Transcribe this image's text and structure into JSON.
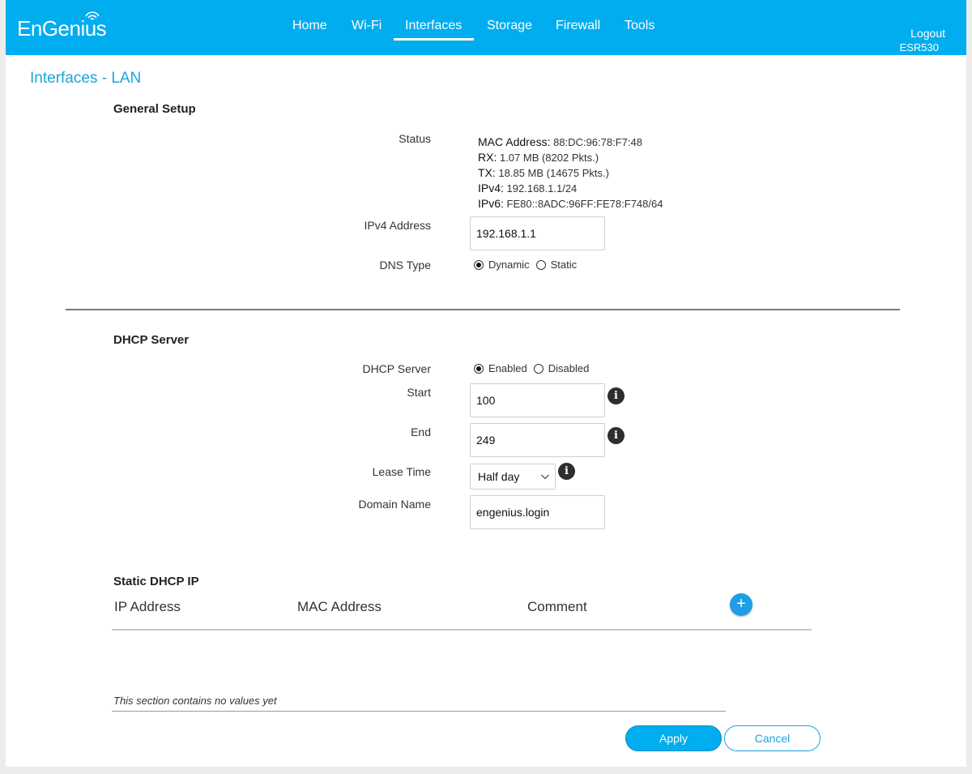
{
  "brand": {
    "logo_text": "EnGenius",
    "model": "ESR530"
  },
  "nav": {
    "items": [
      {
        "label": "Home"
      },
      {
        "label": "Wi-Fi"
      },
      {
        "label": "Interfaces"
      },
      {
        "label": "Storage"
      },
      {
        "label": "Firewall"
      },
      {
        "label": "Tools"
      }
    ],
    "active": "Interfaces",
    "logout_label": "Logout"
  },
  "page": {
    "title": "Interfaces - LAN"
  },
  "general_setup": {
    "title": "General Setup",
    "status_label": "Status",
    "status": {
      "mac_key": "MAC Address:",
      "mac_value": "88:DC:96:78:F7:48",
      "rx_key": "RX:",
      "rx_value": "1.07 MB (8202 Pkts.)",
      "tx_key": "TX:",
      "tx_value": "18.85 MB (14675 Pkts.)",
      "ipv4_key": "IPv4:",
      "ipv4_value": "192.168.1.1/24",
      "ipv6_key": "IPv6:",
      "ipv6_value": "FE80::8ADC:96FF:FE78:F748/64"
    },
    "ipv4_label": "IPv4 Address",
    "ipv4_value": "192.168.1.1",
    "dns_label": "DNS Type",
    "dns_options": [
      "Dynamic",
      "Static"
    ],
    "dns_selected": "Dynamic"
  },
  "dhcp_server": {
    "title": "DHCP Server",
    "server_label": "DHCP Server",
    "server_options": [
      "Enabled",
      "Disabled"
    ],
    "server_selected": "Enabled",
    "start_label": "Start",
    "start_value": "100",
    "end_label": "End",
    "end_value": "249",
    "lease_label": "Lease Time",
    "lease_value": "Half day",
    "domain_label": "Domain Name",
    "domain_value": "engenius.login",
    "info_glyph": "i"
  },
  "static_dhcp": {
    "title": "Static DHCP IP",
    "columns": [
      "IP Address",
      "MAC Address",
      "Comment"
    ],
    "add_glyph": "+",
    "empty_message": "This section contains no values yet"
  },
  "actions": {
    "apply_label": "Apply",
    "cancel_label": "Cancel"
  },
  "colors": {
    "header_bg": "#00adef",
    "title_blue": "#1aa6dc",
    "add_button": "#1d9ee6"
  },
  "icons": {
    "info": "info-icon",
    "add": "plus-icon",
    "select": "chevron-down-icon",
    "logo": "wifi-arcs-icon"
  }
}
